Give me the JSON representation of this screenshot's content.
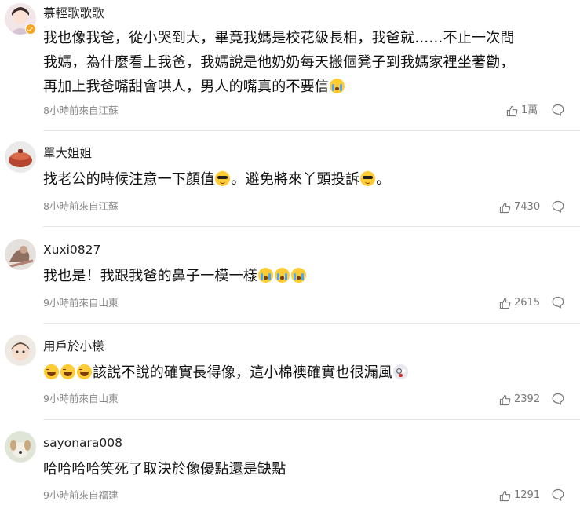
{
  "comments": [
    {
      "username": "慕輕歌歌歌",
      "verified": true,
      "content_lines": [
        "我也像我爸，從小哭到大，畢竟我媽是校花級長相，我爸就……不止一次問",
        "我媽，為什麼看上我爸，我媽說是他奶奶每天搬個凳子到我媽家裡坐著勸，",
        "再加上我爸嘴甜會哄人，男人的嘴真的不要信"
      ],
      "emoji_end": "cry",
      "meta": "8小時前來自江蘇",
      "likes": "1萬"
    },
    {
      "username": "單大姐姐",
      "content_parts": [
        "找老公的時候注意一下顏值",
        "。避免將來丫頭投訴",
        "。"
      ],
      "meta": "8小時前來自江蘇",
      "likes": "7430"
    },
    {
      "username": "Xuxi0827",
      "content": "我也是！我跟我爸的鼻子一模一樣",
      "meta": "9小時前來自山東",
      "likes": "2615"
    },
    {
      "username": "用戶於小樣",
      "content": "該說不說的確實長得像，這小棉襖確實也很漏風",
      "meta": "9小時前來自山東",
      "likes": "2392"
    },
    {
      "username": "sayonara008",
      "content": "哈哈哈哈笑死了取決於像優點還是缺點",
      "meta": "9小時前來自福建",
      "likes": "1291"
    }
  ],
  "icons": {
    "like": "thumbs-up-icon",
    "reply": "comment-bubble-icon",
    "verified": "verified-badge-icon"
  },
  "colors": {
    "meta_text": "#888888",
    "divider": "#e8e8e8",
    "verified_badge": "#f5a623"
  }
}
